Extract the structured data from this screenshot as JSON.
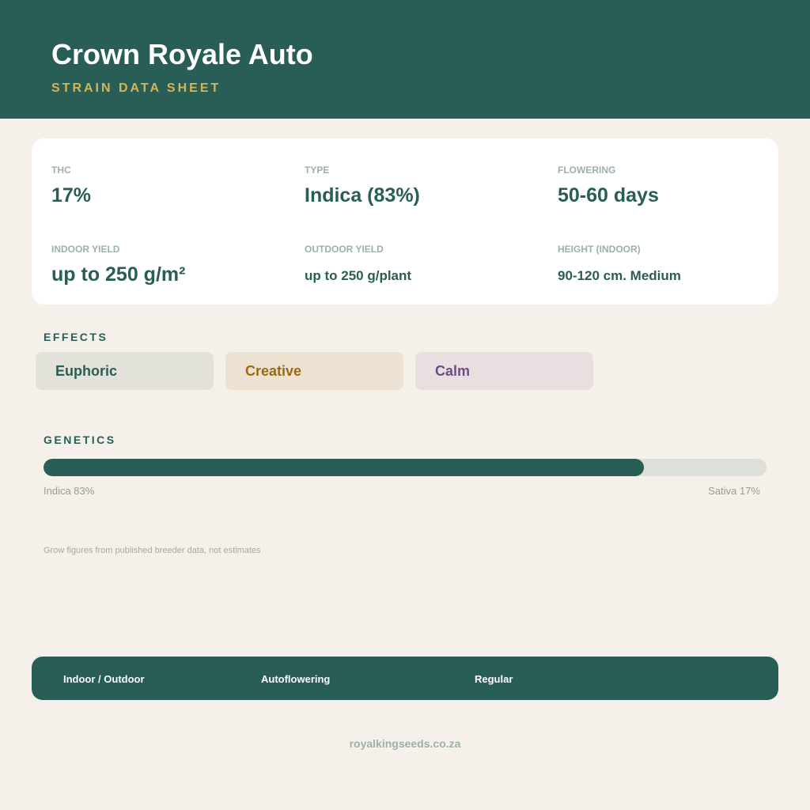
{
  "header": {
    "title": "Crown Royale Auto",
    "subtitle": "STRAIN DATA SHEET"
  },
  "stats": {
    "thc": {
      "label": "THC",
      "value": "17%"
    },
    "type": {
      "label": "TYPE",
      "value": "Indica (83%)"
    },
    "flowering": {
      "label": "FLOWERING",
      "value": "50-60 days"
    },
    "indoor_yield": {
      "label": "INDOOR YIELD",
      "value": "up to 250 g/m²"
    },
    "outdoor_yield": {
      "label": "OUTDOOR YIELD",
      "value": "up to 250 g/plant"
    },
    "height_indoor": {
      "label": "HEIGHT (INDOOR)",
      "value": "90-120 cm. Medium"
    }
  },
  "effects": {
    "label": "EFFECTS",
    "items": [
      {
        "text": "Euphoric",
        "color": "#285e56",
        "bg": "#e2e2da"
      },
      {
        "text": "Creative",
        "color": "#9a6a12",
        "bg": "#ede2d2"
      },
      {
        "text": "Calm",
        "color": "#6f4a8a",
        "bg": "#e8e0e0"
      }
    ]
  },
  "genetics": {
    "label": "GENETICS",
    "indica_percent": 83,
    "sativa_percent": 17,
    "indica_caption": "Indica 83%",
    "sativa_caption": "Sativa 17%"
  },
  "note": "Grow figures from published breeder data, not estimates",
  "footer": {
    "environment": "Indoor / Outdoor",
    "flowering_type": "Autoflowering",
    "seed_type": "Regular"
  },
  "website": "royalkingseeds.co.za",
  "colors": {
    "primary": "#285e56",
    "accent": "#d2b65a",
    "background": "#f5f0ea",
    "track": "#dedfd8"
  }
}
